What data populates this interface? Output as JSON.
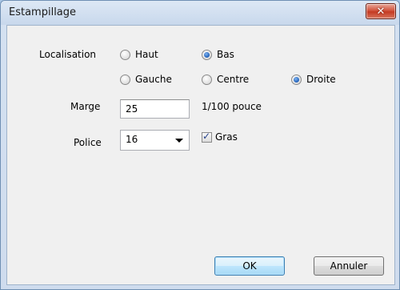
{
  "window": {
    "title": "Estampillage",
    "close_glyph": "✕"
  },
  "location": {
    "label": "Localisation",
    "options": {
      "haut": "Haut",
      "bas": "Bas",
      "gauche": "Gauche",
      "centre": "Centre",
      "droite": "Droite"
    },
    "selected_vertical": "Bas",
    "selected_horizontal": "Droite"
  },
  "margin": {
    "label": "Marge",
    "value": "25",
    "unit": "1/100 pouce"
  },
  "font": {
    "label": "Police",
    "value": "16",
    "bold_label": "Gras",
    "bold_checked": true
  },
  "buttons": {
    "ok": "OK",
    "cancel": "Annuler"
  }
}
